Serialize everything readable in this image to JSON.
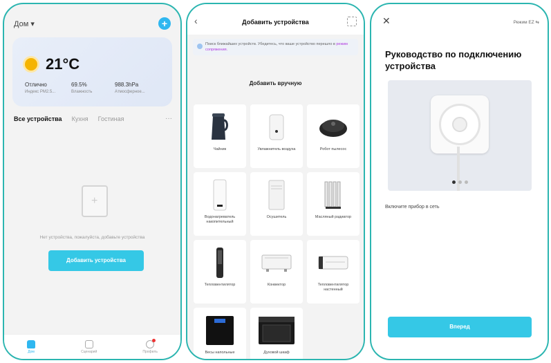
{
  "home": {
    "title": "Дом",
    "temp": "21°C",
    "weather_stats": [
      {
        "value": "Отлично",
        "sub": "Индекс PM2.5..."
      },
      {
        "value": "69.5%",
        "sub": "Влажность"
      },
      {
        "value": "988.3hPa",
        "sub": "Атмосферное..."
      }
    ],
    "tabs": [
      "Все устройства",
      "Кухня",
      "Гостиная"
    ],
    "empty_text": "Нет устройства, пожалуйста, добавьте устройства",
    "add_button": "Добавить устройства",
    "nav": [
      "Дом",
      "Сценарий",
      "Профиль"
    ]
  },
  "add_device": {
    "title": "Добавить устройства",
    "search_text": "Поиск ближайших устройств. Убедитесь, что ваше устройство перешло в",
    "search_link": "режим сопряжения.",
    "manual_title": "Добавить вручную",
    "devices": [
      {
        "label": "Чайник",
        "icon": "kettle-icon"
      },
      {
        "label": "Увлажнитель воздуха",
        "icon": "humidifier-icon"
      },
      {
        "label": "Робот пылесос",
        "icon": "robot-vacuum-icon"
      },
      {
        "label": "Водонагреватель накопительный",
        "icon": "water-heater-icon"
      },
      {
        "label": "Осушитель",
        "icon": "dehumidifier-icon"
      },
      {
        "label": "Масляный радиатор",
        "icon": "oil-radiator-icon"
      },
      {
        "label": "Тепловентилятор",
        "icon": "fan-heater-icon"
      },
      {
        "label": "Конвектор",
        "icon": "convector-icon"
      },
      {
        "label": "Тепловентилятор настенный",
        "icon": "wall-heater-icon"
      },
      {
        "label": "Весы напольные",
        "icon": "scale-icon"
      },
      {
        "label": "Духовой шкаф",
        "icon": "oven-icon"
      }
    ]
  },
  "guide": {
    "mode": "Режим EZ",
    "title": "Руководство по подключению устройства",
    "instruction": "Включите прибор в сеть",
    "next_button": "Вперед"
  },
  "colors": {
    "accent": "#35c8e6",
    "frame": "#2bb5b0",
    "link": "#b03ae0"
  }
}
